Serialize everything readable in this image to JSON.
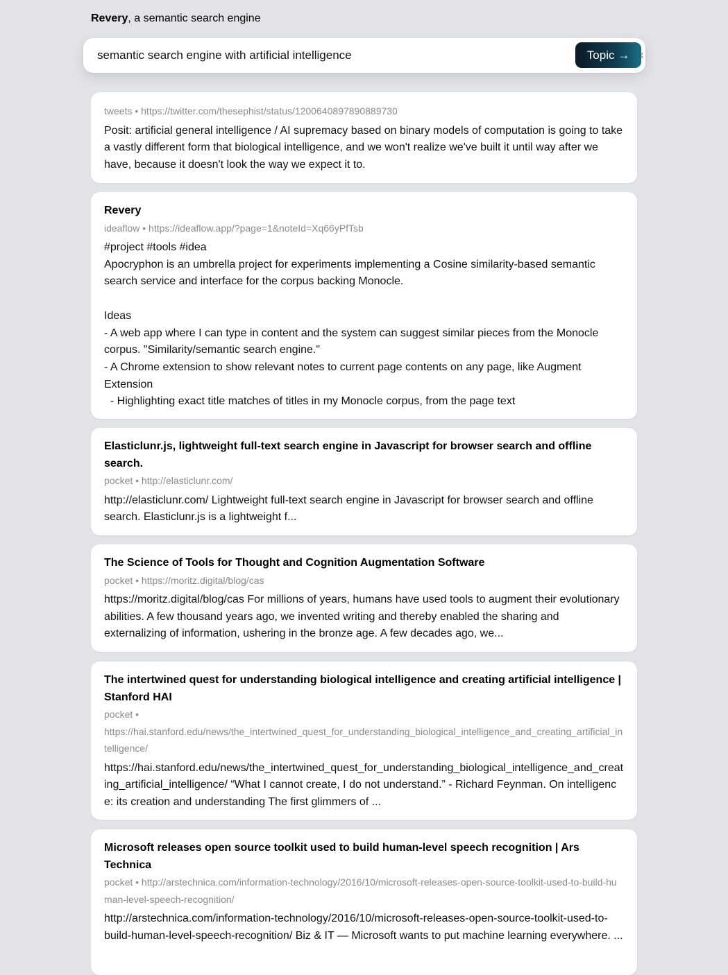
{
  "app": {
    "brand": "Revery",
    "tagline": ", a semantic search engine"
  },
  "search": {
    "query": "semantic search engine with artificial intelligence",
    "clear_icon": "×",
    "topic_button_label": "Topic →"
  },
  "results": [
    {
      "title": "",
      "meta": "tweets • https://twitter.com/thesephist/status/1200640897890889730",
      "body": "Posit: artificial general intelligence / AI supremacy based on binary models of computation is going to take a vastly different form that biological intelligence, and we won't realize we've built it until way after we have, because it doesn't look the way we expect it to."
    },
    {
      "title": "Revery",
      "meta": "ideaflow • https://ideaflow.app/?page=1&noteId=Xq66yPfTsb",
      "body": "#project #tools #idea\nApocryphon is an umbrella project for experiments implementing a Cosine similarity-based semantic search service and interface for the corpus backing Monocle.\n\nIdeas\n- A web app where I can type in content and the system can suggest similar pieces from the Monocle corpus. \"Similarity/semantic search engine.\"\n- A Chrome extension to show relevant notes to current page contents on any page, like Augment Extension\n  - Highlighting exact title matches of titles in my Monocle corpus, from the page text"
    },
    {
      "title": "Elasticlunr.js, lightweight full-text search engine in Javascript for browser search and offline search.",
      "meta": "pocket • http://elasticlunr.com/",
      "body": "http://elasticlunr.com/ Lightweight full-text search engine in Javascript for browser search and offline search. Elasticlunr.js is a lightweight f..."
    },
    {
      "title": "The Science of Tools for Thought and Cognition Augmentation Software",
      "meta": "pocket • https://moritz.digital/blog/cas",
      "body": "https://moritz.digital/blog/cas For millions of years, humans have used tools to augment their evolutionary abilities. A few thousand years ago, we invented writing and thereby enabled the sharing and externalizing of information, ushering in the bronze age. A few decades ago, we..."
    },
    {
      "title": "The intertwined quest for understanding biological intelligence and creating artificial intelligence | Stanford HAI",
      "meta_source": "pocket •",
      "meta": "https://hai.stanford.edu/news/the_intertwined_quest_for_understanding_biological_intelligence_and_creating_artificial_intelligence/",
      "body": "https://hai.stanford.edu/news/the_intertwined_quest_for_understanding_biological_intelligence_and_creating_artificial_intelligence/ “What I cannot create, I do not understand.” - Richard Feynman. On intelligence: its creation and understanding The first glimmers of ..."
    },
    {
      "title": "Microsoft releases open source toolkit used to build human-level speech recognition | Ars Technica",
      "meta": "pocket • http://arstechnica.com/information-technology/2016/10/microsoft-releases-open-source-toolkit-used-to-build-human-level-speech-recognition/",
      "body": "http://arstechnica.com/information-technology/2016/10/microsoft-releases-open-source-toolkit-used-to-build-human-level-speech-recognition/ Biz & IT — Microsoft wants to put machine learning everywhere. ..."
    }
  ]
}
